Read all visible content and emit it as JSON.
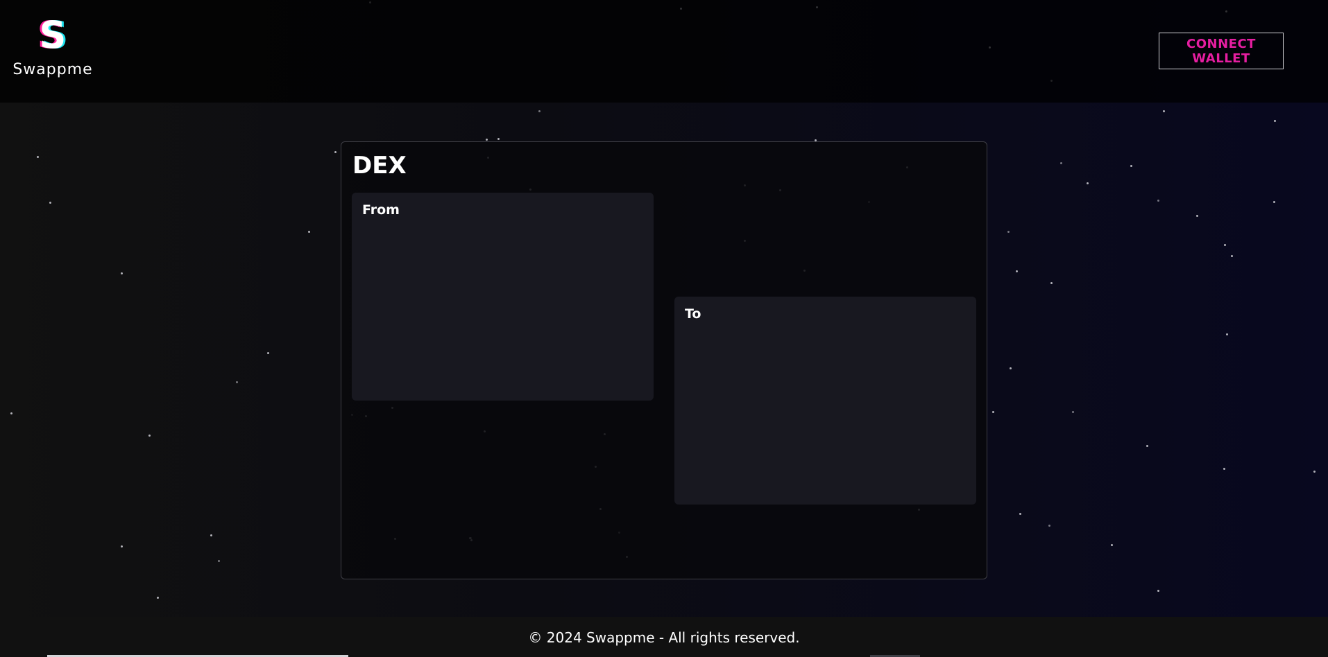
{
  "app": {
    "brand_initial": "S",
    "brand_name": "Swappme"
  },
  "header": {
    "connect_button_label": "CONNECT WALLET"
  },
  "dex": {
    "title": "DEX",
    "from_label": "From",
    "to_label": "To"
  },
  "footer": {
    "text": "© 2024 Swappme - All rights reserved."
  },
  "colors": {
    "accent": "#e61ea1",
    "logo_pink": "#ff1f9b",
    "logo_cyan": "#1ee6f2",
    "card_border": "#3f3f46",
    "panel_background": "#181820"
  }
}
